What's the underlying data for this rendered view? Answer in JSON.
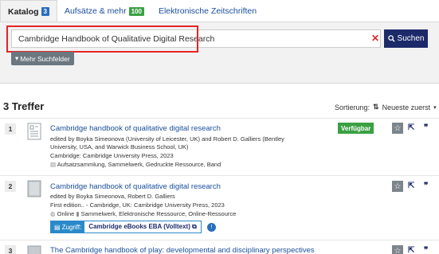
{
  "tabs": [
    {
      "label": "Katalog",
      "count": "3"
    },
    {
      "label": "Aufsätze & mehr",
      "count": "100"
    },
    {
      "label": "Elektronische Zeitschriften"
    }
  ],
  "search": {
    "value": "Cambridge Handbook of Qualitative Digital Research",
    "button_label": "Suchen",
    "more_fields_label": "Mehr Suchfelder"
  },
  "results": {
    "count_label": "3 Treffer",
    "sort_label": "Sortierung:",
    "sort_value": "Neueste zuerst"
  },
  "items": [
    {
      "num": "1",
      "title": "Cambridge handbook of qualitative digital research",
      "line1": "edited by Boyka Simeonova (University of Leicester, UK) and Robert D. Galliers (Bentley",
      "line2": "University, USA, and Warwick Business School, UK)",
      "line3": "Cambridge: Cambridge University Press, 2023",
      "line4": "Aufsatzsammlung, Sammelwerk, Gedruckte Ressource, Band",
      "availability": "Verfügbar"
    },
    {
      "num": "2",
      "title": "Cambridge handbook of qualitative digital research",
      "line1": "edited by Boyka Simeonova, Robert D. Galliers",
      "line2": "First edition.. - Cambridge, UK: Cambridge University Press, 2023",
      "line3_online": "Online",
      "line3": "Sammelwerk, Elektronische Ressource, Online-Ressource",
      "access_label": "Zugriff:",
      "access_value": "Cambridge eBooks EBA (Volltext)"
    },
    {
      "num": "3",
      "title": "The Cambridge handbook of play: developmental and disciplinary perspectives"
    }
  ],
  "icons": {
    "star": "☆",
    "export": "⇱",
    "quote": "❞"
  }
}
